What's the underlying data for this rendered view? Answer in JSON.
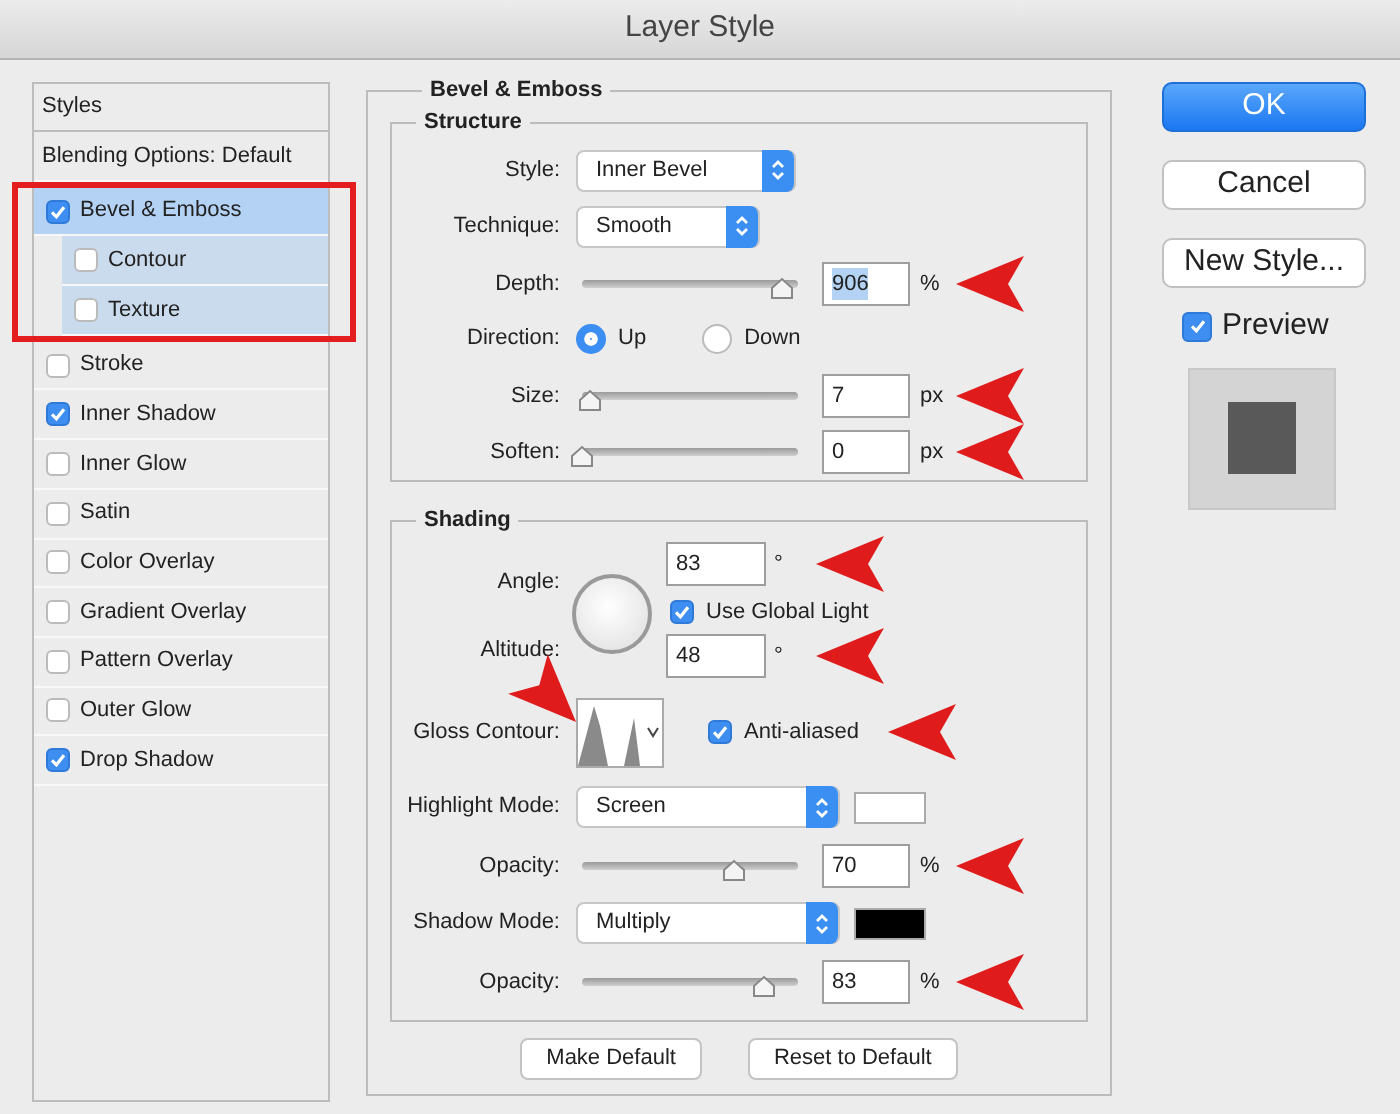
{
  "window": {
    "title": "Layer Style"
  },
  "styles_panel": {
    "header": "Styles",
    "blending_options": "Blending Options: Default",
    "items": [
      {
        "name": "Bevel & Emboss",
        "checked": true,
        "selected": true,
        "boxed": true,
        "children": [
          {
            "name": "Contour",
            "checked": false,
            "selected": false,
            "boxed": true
          },
          {
            "name": "Texture",
            "checked": false,
            "selected": false,
            "boxed": true
          }
        ]
      },
      {
        "name": "Stroke",
        "checked": false,
        "selected": false,
        "boxed": false
      },
      {
        "name": "Inner Shadow",
        "checked": true,
        "selected": false,
        "boxed": false
      },
      {
        "name": "Inner Glow",
        "checked": false,
        "selected": false,
        "boxed": false
      },
      {
        "name": "Satin",
        "checked": false,
        "selected": false,
        "boxed": false
      },
      {
        "name": "Color Overlay",
        "checked": false,
        "selected": false,
        "boxed": false
      },
      {
        "name": "Gradient Overlay",
        "checked": false,
        "selected": false,
        "boxed": false
      },
      {
        "name": "Pattern Overlay",
        "checked": false,
        "selected": false,
        "boxed": false
      },
      {
        "name": "Outer Glow",
        "checked": false,
        "selected": false,
        "boxed": false
      },
      {
        "name": "Drop Shadow",
        "checked": true,
        "selected": false,
        "boxed": false
      }
    ]
  },
  "bevel_emboss": {
    "title": "Bevel & Emboss",
    "structure": {
      "title": "Structure",
      "rows": [
        {
          "kind": "select",
          "label": "Style:",
          "value": "Inner Bevel"
        },
        {
          "kind": "select",
          "label": "Technique:",
          "value": "Smooth"
        },
        {
          "kind": "slider",
          "label": "Depth:",
          "level": 0.93,
          "value": "906",
          "unit": "%",
          "value_selected": true,
          "arrow": true
        },
        {
          "kind": "radio",
          "label": "Direction:",
          "options": [
            {
              "label": "Up",
              "selected": true
            },
            {
              "label": "Down",
              "selected": false
            }
          ]
        },
        {
          "kind": "slider",
          "label": "Size:",
          "level": 0.04,
          "value": "7",
          "unit": "px",
          "arrow": true
        },
        {
          "kind": "slider",
          "label": "Soften:",
          "level": 0,
          "value": "0",
          "unit": "px",
          "arrow": true
        }
      ]
    },
    "shading": {
      "title": "Shading",
      "angle": {
        "label": "Angle:",
        "value": "83",
        "unit": "°",
        "arrow": true
      },
      "use_global_light": {
        "label": "Use Global Light",
        "checked": true
      },
      "altitude": {
        "label": "Altitude:",
        "value": "48",
        "unit": "°",
        "arrow": true
      },
      "gloss_contour": {
        "label": "Gloss Contour:",
        "arrow": true
      },
      "anti_aliased": {
        "label": "Anti-aliased",
        "checked": true,
        "arrow": true
      },
      "rows": [
        {
          "kind": "select",
          "label": "Highlight Mode:",
          "value": "Screen",
          "color": "#ffffff"
        },
        {
          "kind": "slider",
          "label": "Opacity:",
          "level": 0.7,
          "value": "70",
          "unit": "%",
          "arrow": true
        },
        {
          "kind": "select",
          "label": "Shadow Mode:",
          "value": "Multiply",
          "color": "#000000"
        },
        {
          "kind": "slider",
          "label": "Opacity:",
          "level": 0.84,
          "value": "83",
          "unit": "%",
          "arrow": true
        }
      ]
    },
    "buttons": [
      "Make Default",
      "Reset to Default"
    ]
  },
  "actions": [
    {
      "label": "OK",
      "kind": "primary"
    },
    {
      "label": "Cancel",
      "kind": "default"
    },
    {
      "label": "New Style...",
      "kind": "default"
    }
  ],
  "preview": {
    "label": "Preview",
    "checked": true
  }
}
